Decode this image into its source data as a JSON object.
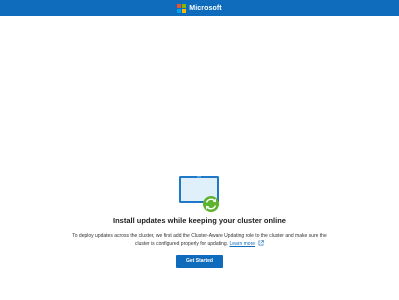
{
  "header": {
    "brand": "Microsoft"
  },
  "main": {
    "title": "Install updates while keeping your cluster online",
    "description": "To deploy updates across the cluster, we first add the Cluster-Aware Updating role to the cluster and make sure the cluster is configured properly for updating.",
    "learn_more": "Learn more",
    "cta_label": "Get Started"
  },
  "icons": {
    "logo": "microsoft-logo",
    "illustration": "monitor-sync-icon",
    "external": "external-link-icon"
  },
  "colors": {
    "header_bg": "#0f6cbd",
    "accent": "#0f6cbd",
    "logo_red": "#f25022",
    "logo_green": "#7fba00",
    "logo_blue": "#00a4ef",
    "logo_yellow": "#ffb900",
    "sync_green": "#5db32d"
  }
}
